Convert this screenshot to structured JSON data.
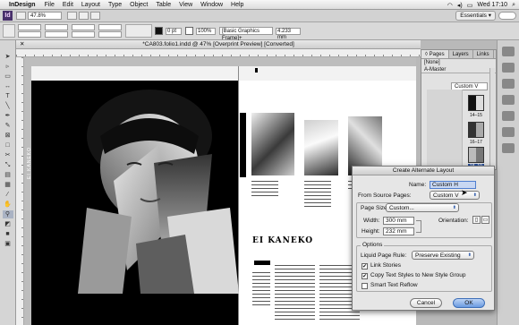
{
  "menubar": {
    "app": "InDesign",
    "items": [
      "File",
      "Edit",
      "Layout",
      "Type",
      "Object",
      "Table",
      "View",
      "Window",
      "Help"
    ],
    "clock": "Wed 17:10"
  },
  "appbar": {
    "logo": "Id",
    "zoom": "47.8%",
    "workspace": "Essentials ▾"
  },
  "control": {
    "stroke_pt": "0 pt",
    "zoom2": "100%",
    "object_style": "[Basic Graphics Frame]+",
    "dimension": "4.233 mm"
  },
  "document": {
    "tab_title": "*CA803.folio1.indd @ 47% [Overprint Preview] [Converted]"
  },
  "canvas": {
    "vertical_text": "EI KANEKO",
    "author": "EI KANEKO",
    "page_marker": "1"
  },
  "pages_panel": {
    "tabs": [
      "◊ Pages",
      "Layers",
      "Links"
    ],
    "none_label": "[None]",
    "master_label": "A-Master",
    "layout_select": "Custom V",
    "spreads": [
      "14–15",
      "16–17",
      "18–19"
    ]
  },
  "dialog": {
    "title": "Create Alternate Layout",
    "name_label": "Name:",
    "name_value": "Custom H",
    "from_label": "From Source Pages:",
    "from_value": "Custom V",
    "page_size_label": "Page Size:",
    "page_size_value": "Custom...",
    "width_label": "Width:",
    "width_value": "300 mm",
    "height_label": "Height:",
    "height_value": "232 mm",
    "orientation_label": "Orientation:",
    "options_label": "Options",
    "liquid_label": "Liquid Page Rule:",
    "liquid_value": "Preserve Existing",
    "link_stories": "Link Stories",
    "copy_styles": "Copy Text Styles to New Style Group",
    "smart_reflow": "Smart Text Reflow",
    "link_stories_checked": true,
    "copy_styles_checked": true,
    "smart_reflow_checked": false,
    "cancel": "Cancel",
    "ok": "OK"
  },
  "colors": {
    "accent": "#4f7ecf",
    "id_logo": "#48306b"
  }
}
